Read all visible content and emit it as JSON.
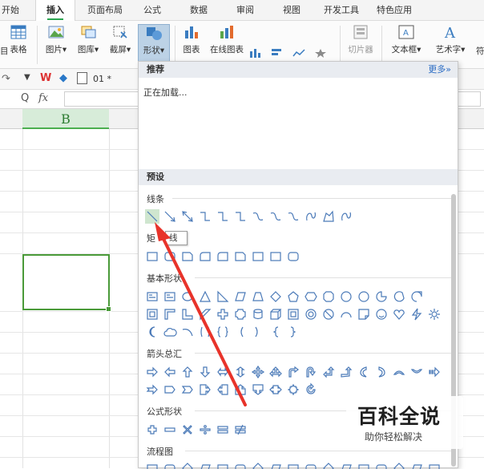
{
  "tabs": [
    "开始",
    "插入",
    "页面布局",
    "公式",
    "数据",
    "审阅",
    "视图",
    "开发工具",
    "特色应用"
  ],
  "active_tab": "插入",
  "ribbon": {
    "table_cut": "目",
    "table": "表格",
    "picture": "图片",
    "gallery": "图库",
    "screenshot": "截屏",
    "shapes": "形状",
    "chart": "图表",
    "online_chart": "在线图表",
    "slicer": "切片器",
    "textbox": "文本框",
    "wordart": "艺术字",
    "symbol_cut": "符"
  },
  "quick_bar": {
    "doc_tab": "01 *"
  },
  "formula_bar": {
    "fx": "fx",
    "zoom_glyph": "Q"
  },
  "sheet": {
    "column_b": "B"
  },
  "shapes_panel": {
    "recommended_title": "推荐",
    "more_label": "更多»",
    "loading_text": "正在加载...",
    "presets_title": "预设",
    "sections": {
      "lines": "线条",
      "rectangles_cut": "矩",
      "basic_shapes": "基本形状",
      "block_arrows": "箭头总汇",
      "equation_shapes": "公式形状",
      "flowchart": "流程图"
    },
    "tooltip_cut": "线"
  },
  "watermark": {
    "brand": "百科全说",
    "tagline": "助你轻松解决"
  },
  "colors": {
    "accent_green": "#2aa550",
    "cell_border": "#4a9a39",
    "shape_stroke": "#4b7ab8",
    "annotation_arrow": "#e8332a"
  }
}
